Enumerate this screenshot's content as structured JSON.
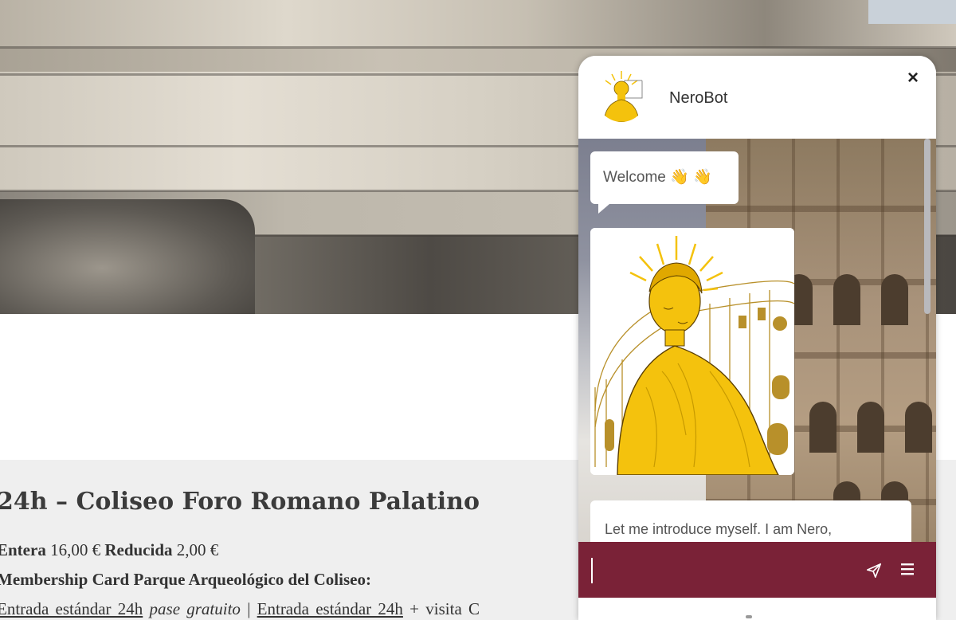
{
  "product": {
    "title": "24h – Coliseo Foro Romano Palatino",
    "price_entera_label": "Entera",
    "price_entera": "16,00 €",
    "price_reducida_label": "Reducida",
    "price_reducida": "2,00 €",
    "membership": "Membership Card Parque Arqueológico del Coliseo:",
    "ticket_1": "Entrada estándar 24h",
    "ticket_free": "pase gratuito",
    "ticket_sep": "|",
    "ticket_2": "Entrada estándar 24h",
    "ticket_tail": "+ visita C"
  },
  "chat": {
    "bot_name": "NeroBot",
    "close_label": "×",
    "messages": {
      "welcome": "Welcome 👋 👋",
      "intro": "Let me introduce myself. I am Nero,"
    },
    "input_placeholder": "",
    "colors": {
      "accent": "#7a2237",
      "gold": "#f4c20d"
    },
    "icons": {
      "send": "send-icon",
      "menu": "menu-icon",
      "close": "close-icon"
    }
  }
}
